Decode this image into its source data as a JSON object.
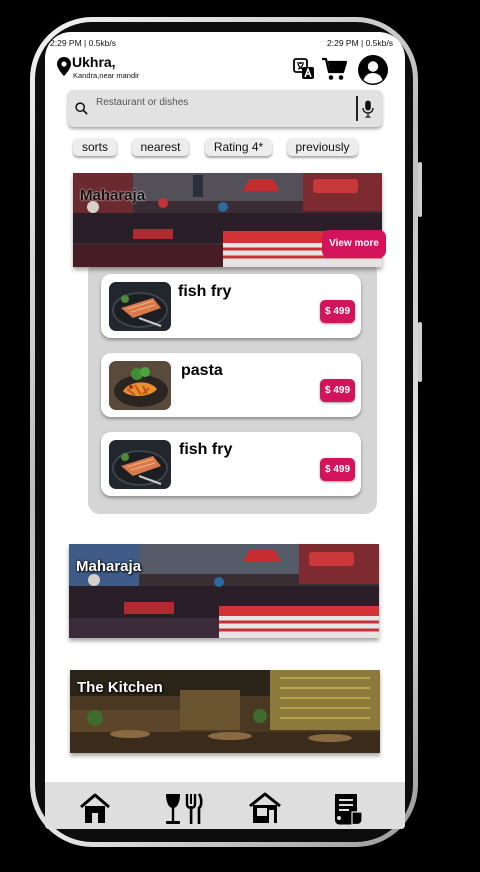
{
  "status_bar": {
    "left": "2:29 PM | 0.5kb/s",
    "right": "2:29 PM | 0.5kb/s"
  },
  "location": {
    "title": "Ukhra,",
    "subtitle": "Kandra,near mandir"
  },
  "header_icons": [
    "translate-icon",
    "cart-icon",
    "account-icon"
  ],
  "search": {
    "placeholder": "Restaurant or dishes",
    "icons": [
      "search-icon",
      "mic-icon"
    ]
  },
  "filters": [
    "sorts",
    "nearest",
    "Rating 4*",
    "previously"
  ],
  "featured": {
    "name": "Maharaja",
    "view_more": "View more",
    "items": [
      {
        "name": "fish fry",
        "price": "$ 499"
      },
      {
        "name": "pasta",
        "price": "$ 499"
      },
      {
        "name": "fish fry",
        "price": "$ 499"
      }
    ]
  },
  "restaurants": [
    {
      "name": "Maharaja"
    },
    {
      "name": "The Kitchen"
    }
  ],
  "bottom_nav": [
    "home-icon",
    "dining-icon",
    "store-icon",
    "orders-icon"
  ],
  "colors": {
    "accent": "#d4145a",
    "background": "#ffffff",
    "chip": "#ededed"
  }
}
